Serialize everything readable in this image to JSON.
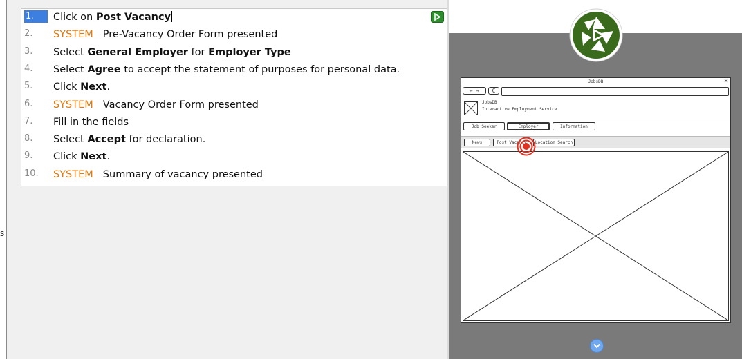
{
  "left_sliver": {
    "text": "s"
  },
  "steps": [
    {
      "num": "1.",
      "selected": true,
      "system": "",
      "parts": [
        [
          "Click on ",
          false
        ],
        [
          "Post Vacancy",
          true
        ]
      ]
    },
    {
      "num": "2.",
      "system": "SYSTEM",
      "parts": [
        [
          "Pre-Vacancy Order Form presented",
          false
        ]
      ]
    },
    {
      "num": "3.",
      "system": "",
      "parts": [
        [
          "Select ",
          false
        ],
        [
          "General Employer",
          true
        ],
        [
          " for ",
          false
        ],
        [
          "Employer Type",
          true
        ]
      ]
    },
    {
      "num": "4.",
      "system": "",
      "parts": [
        [
          "Select ",
          false
        ],
        [
          "Agree",
          true
        ],
        [
          " to accept the statement of purposes for personal data.",
          false
        ]
      ]
    },
    {
      "num": "5.",
      "system": "",
      "parts": [
        [
          "Click ",
          false
        ],
        [
          "Next",
          true
        ],
        [
          ".",
          false
        ]
      ]
    },
    {
      "num": "6.",
      "system": "SYSTEM",
      "parts": [
        [
          "Vacancy Order Form presented",
          false
        ]
      ]
    },
    {
      "num": "7.",
      "system": "",
      "parts": [
        [
          "Fill in the fields",
          false
        ]
      ]
    },
    {
      "num": "8.",
      "system": "",
      "parts": [
        [
          "Select ",
          false
        ],
        [
          "Accept",
          true
        ],
        [
          " for declaration.",
          false
        ]
      ]
    },
    {
      "num": "9.",
      "system": "",
      "parts": [
        [
          "Click ",
          false
        ],
        [
          "Next",
          true
        ],
        [
          ".",
          false
        ]
      ]
    },
    {
      "num": "10.",
      "system": "SYSTEM",
      "parts": [
        [
          "Summary of vacancy presented",
          false
        ]
      ]
    }
  ],
  "play_button": {
    "icon": "play-icon",
    "color": "#2f8f2f"
  },
  "preview": {
    "logo_icon": "shutter-play-logo",
    "mock": {
      "window_title": "JobsDB",
      "close_glyph": "✕",
      "nav_back": "←",
      "nav_forward": "→",
      "nav_reload": "C",
      "site_name": "JobsDB",
      "site_subtitle": "Interactive Employment Service",
      "tabs": [
        {
          "label": "Job Seeker"
        },
        {
          "label": "Employer"
        },
        {
          "label": "Information"
        }
      ],
      "sub_buttons": [
        {
          "label": "News"
        },
        {
          "label": "Post Vacancy"
        },
        {
          "label": "Location Search"
        }
      ]
    },
    "scroll_down_icon": "chevron-down-circle-icon"
  },
  "colors": {
    "system": "#e07a10",
    "selected": "#3c7fe0",
    "preview_bg": "#7a7a7a",
    "logo_green": "#3a6b1c",
    "marker_red": "#e03020"
  }
}
